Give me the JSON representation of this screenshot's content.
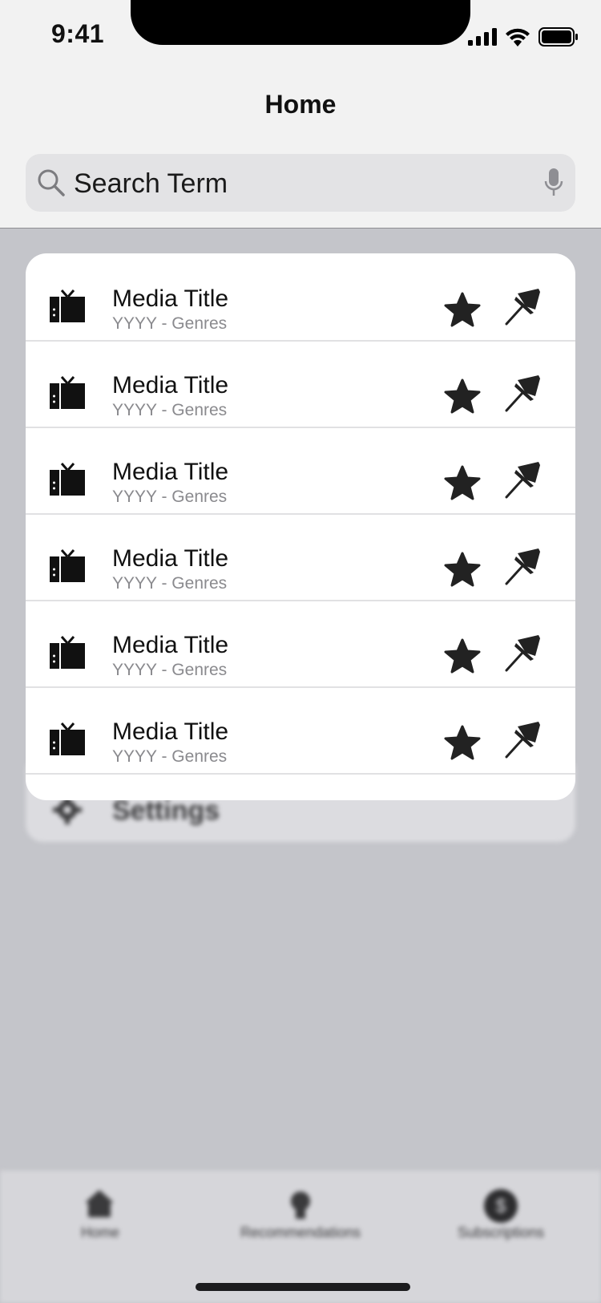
{
  "status_bar": {
    "time": "9:41"
  },
  "header": {
    "title": "Home"
  },
  "search": {
    "term": "Search Term"
  },
  "media_list": [
    {
      "title": "Media Title",
      "subtitle": "YYYY - Genres"
    },
    {
      "title": "Media Title",
      "subtitle": "YYYY - Genres"
    },
    {
      "title": "Media Title",
      "subtitle": "YYYY - Genres"
    },
    {
      "title": "Media Title",
      "subtitle": "YYYY - Genres"
    },
    {
      "title": "Media Title",
      "subtitle": "YYYY - Genres"
    },
    {
      "title": "Media Title",
      "subtitle": "YYYY - Genres"
    }
  ],
  "background_menu": {
    "settings_label": "Settings"
  },
  "tab_bar": {
    "tabs": [
      {
        "label": "Home",
        "icon": "house-icon"
      },
      {
        "label": "Recommendations",
        "icon": "lightbulb-icon"
      },
      {
        "label": "Subscriptions",
        "icon": "dollar-icon"
      }
    ]
  },
  "colors": {
    "accent": "#111111",
    "subtitle": "#8a8a8e",
    "overlay": "#c4c5ca"
  }
}
